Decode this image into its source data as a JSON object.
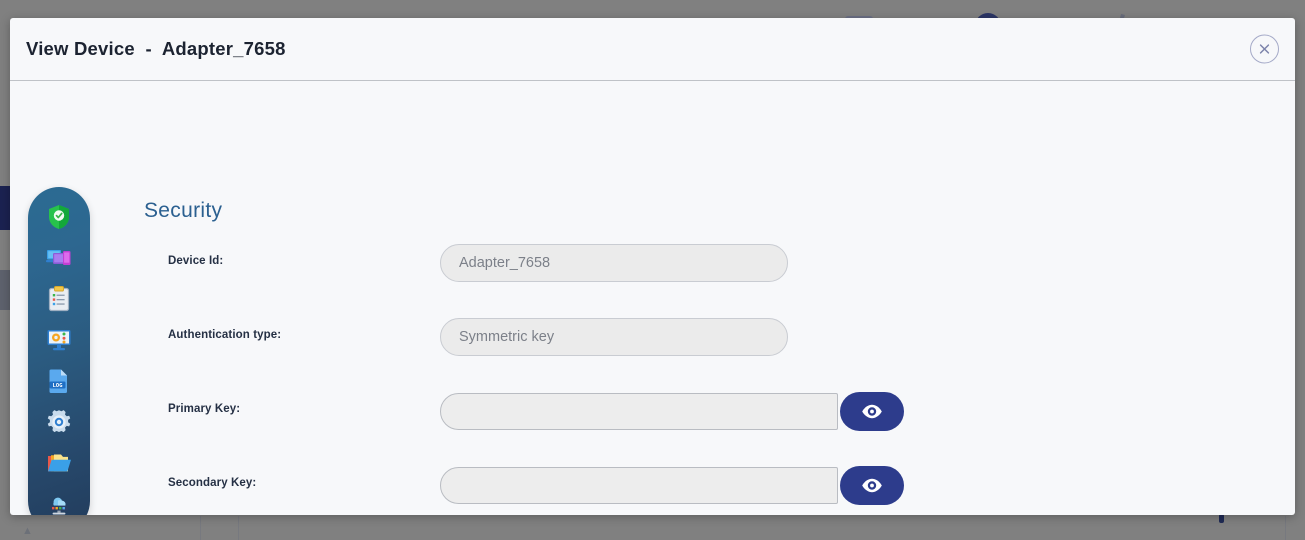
{
  "backdrop": {
    "overlay_color": "#808080"
  },
  "modal": {
    "title": "View Device  -  Adapter_7658",
    "close_icon": "close-circle-icon",
    "section_heading": "Security",
    "accent_color": "#2b6090",
    "button_color": "#2d3c8c"
  },
  "sidebar": {
    "items": [
      {
        "name": "security-shield-icon",
        "label": "Security"
      },
      {
        "name": "devices-icon",
        "label": "Devices"
      },
      {
        "name": "clipboard-icon",
        "label": "Properties"
      },
      {
        "name": "monitor-settings-icon",
        "label": "Configuration"
      },
      {
        "name": "log-file-icon",
        "label": "Logs"
      },
      {
        "name": "gear-icon",
        "label": "Settings"
      },
      {
        "name": "folders-icon",
        "label": "Files"
      },
      {
        "name": "cloud-monitor-icon",
        "label": "Cloud"
      }
    ]
  },
  "form": {
    "fields": [
      {
        "label": "Device Id:",
        "value": "Adapter_7658",
        "placeholder": "Device Id",
        "type": "pill",
        "has_reveal": false
      },
      {
        "label": "Authentication type:",
        "value": "Symmetric key",
        "placeholder": "Authentication type",
        "type": "pill",
        "has_reveal": false
      },
      {
        "label": "Primary Key:",
        "value": "",
        "placeholder": "",
        "type": "key",
        "has_reveal": true,
        "reveal_icon": "eye-icon"
      },
      {
        "label": "Secondary Key:",
        "value": "",
        "placeholder": "",
        "type": "key",
        "has_reveal": true,
        "reveal_icon": "eye-icon"
      }
    ]
  }
}
